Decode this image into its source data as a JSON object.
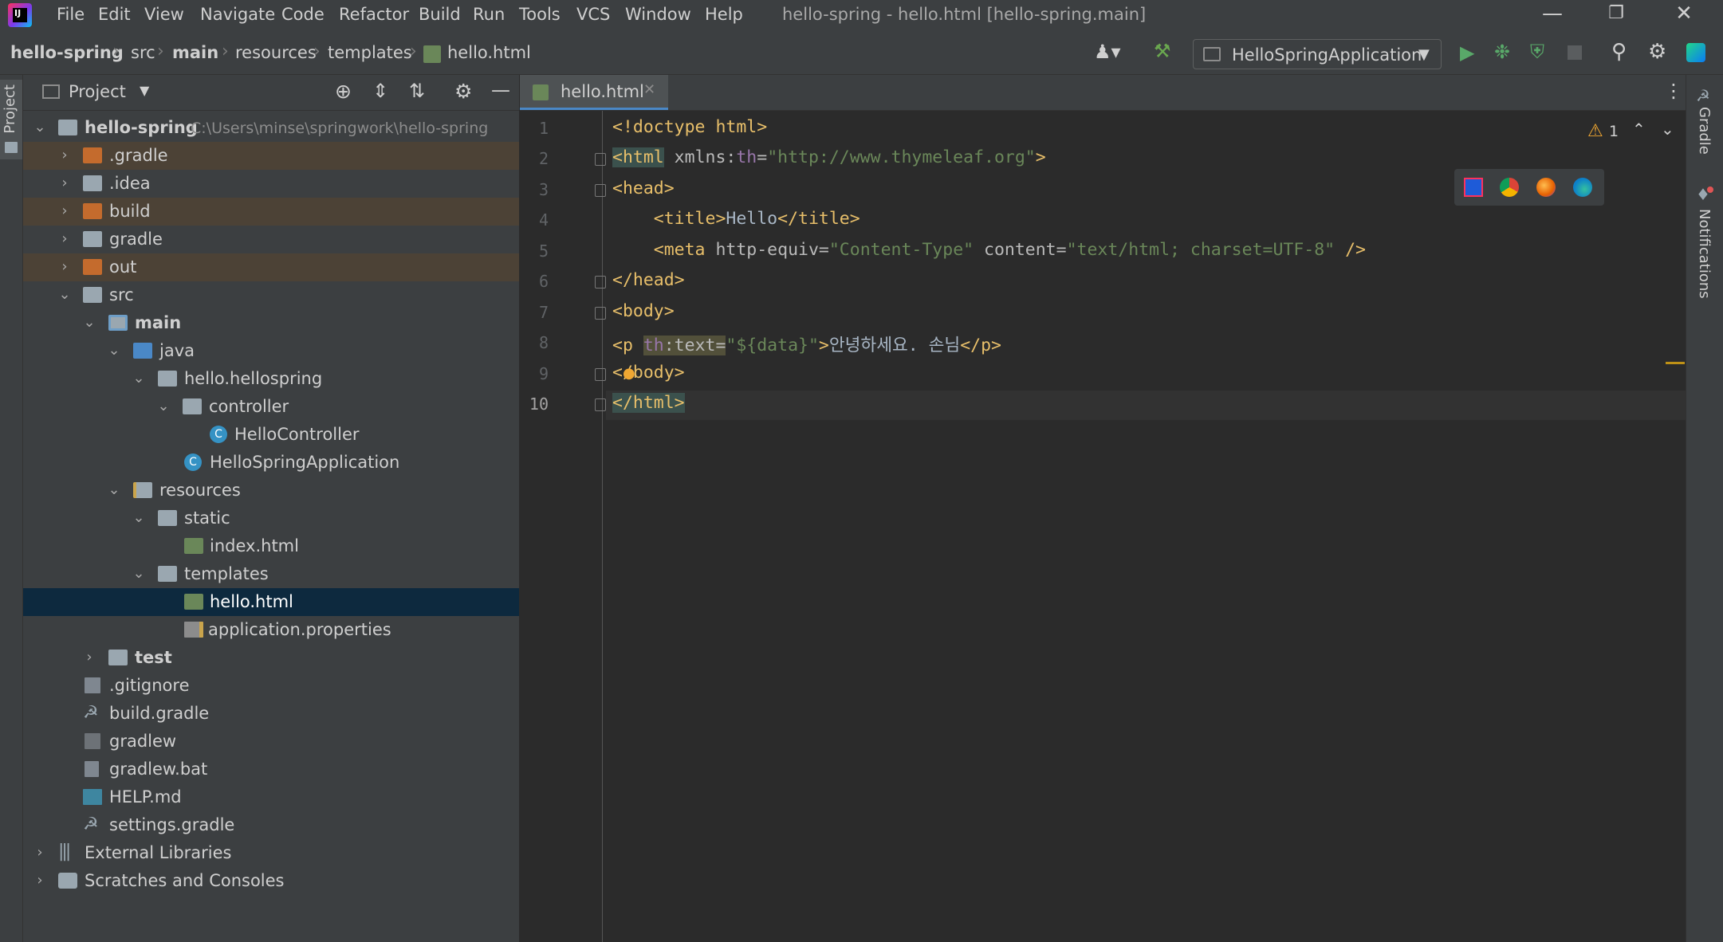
{
  "menubar": {
    "items": [
      "File",
      "Edit",
      "View",
      "Navigate",
      "Code",
      "Refactor",
      "Build",
      "Run",
      "Tools",
      "VCS",
      "Window",
      "Help"
    ],
    "window_title": "hello-spring - hello.html [hello-spring.main]"
  },
  "breadcrumb": [
    "hello-spring",
    "src",
    "main",
    "resources",
    "templates",
    "hello.html"
  ],
  "run_config": {
    "label": "HelloSpringApplication"
  },
  "left_stripe": {
    "project_label": "Project"
  },
  "right_stripe": {
    "gradle_label": "Gradle",
    "notifications_label": "Notifications"
  },
  "project_panel": {
    "title": "Project",
    "root_path": "C:\\Users\\minse\\springwork\\hello-spring",
    "rows": [
      {
        "label": "hello-spring",
        "icon": "module-folder-icon"
      },
      {
        "label": ".gradle",
        "icon": "folder-excluded-icon"
      },
      {
        "label": ".idea",
        "icon": "folder-icon"
      },
      {
        "label": "build",
        "icon": "folder-excluded-icon"
      },
      {
        "label": "gradle",
        "icon": "folder-icon"
      },
      {
        "label": "out",
        "icon": "folder-excluded-icon"
      },
      {
        "label": "src",
        "icon": "folder-icon"
      },
      {
        "label": "main",
        "icon": "source-root-folder-icon"
      },
      {
        "label": "java",
        "icon": "java-source-folder-icon"
      },
      {
        "label": "hello.hellospring",
        "icon": "package-icon"
      },
      {
        "label": "controller",
        "icon": "package-icon"
      },
      {
        "label": "HelloController",
        "icon": "class-icon"
      },
      {
        "label": "HelloSpringApplication",
        "icon": "spring-class-icon"
      },
      {
        "label": "resources",
        "icon": "resources-folder-icon"
      },
      {
        "label": "static",
        "icon": "folder-icon"
      },
      {
        "label": "index.html",
        "icon": "html-file-icon"
      },
      {
        "label": "templates",
        "icon": "folder-icon"
      },
      {
        "label": "hello.html",
        "icon": "html-file-icon"
      },
      {
        "label": "application.properties",
        "icon": "properties-file-icon"
      },
      {
        "label": "test",
        "icon": "folder-icon"
      },
      {
        "label": ".gitignore",
        "icon": "gitignore-file-icon"
      },
      {
        "label": "build.gradle",
        "icon": "gradle-file-icon"
      },
      {
        "label": "gradlew",
        "icon": "shell-file-icon"
      },
      {
        "label": "gradlew.bat",
        "icon": "bat-file-icon"
      },
      {
        "label": "HELP.md",
        "icon": "markdown-file-icon"
      },
      {
        "label": "settings.gradle",
        "icon": "gradle-file-icon"
      },
      {
        "label": "External Libraries",
        "icon": "libraries-icon"
      },
      {
        "label": "Scratches and Consoles",
        "icon": "scratches-icon"
      }
    ]
  },
  "editor": {
    "tab_label": "hello.html",
    "warning_count": "1",
    "line_numbers": [
      "1",
      "2",
      "3",
      "4",
      "5",
      "6",
      "7",
      "8",
      "9",
      "10"
    ],
    "code": {
      "l1": "<!doctype html>",
      "l2_open": "<html",
      "l2_attr": " xmlns:",
      "l2_ns": "th",
      "l2_eq": "=",
      "l2_val": "\"http://www.thymeleaf.org\"",
      "l2_close": ">",
      "l3": "<head>",
      "l4_indent": "    ",
      "l4_open": "<title>",
      "l4_text": "Hello",
      "l4_close": "</title>",
      "l5_indent": "    ",
      "l5_open": "<meta",
      "l5_attr1": " http-equiv=",
      "l5_val1": "\"Content-Type\"",
      "l5_attr2": " content=",
      "l5_val2": "\"text/html; charset=UTF-8\"",
      "l5_close": " />",
      "l6": "</head>",
      "l7": "<body>",
      "l8_open": "<p ",
      "l8_ns": "th",
      "l8_attr": ":text=",
      "l8_val": "\"${data}\"",
      "l8_gt": ">",
      "l8_text": "안녕하세요. 손님",
      "l8_close": "</p>",
      "l9": "</body>",
      "l10": "</html>"
    }
  },
  "colors": {
    "bg_editor": "#2b2b2b",
    "bg_panel": "#3c3f41",
    "selection": "#0d293e",
    "excluded_folder": "#c46b2d",
    "folder": "#9aa7b0"
  }
}
